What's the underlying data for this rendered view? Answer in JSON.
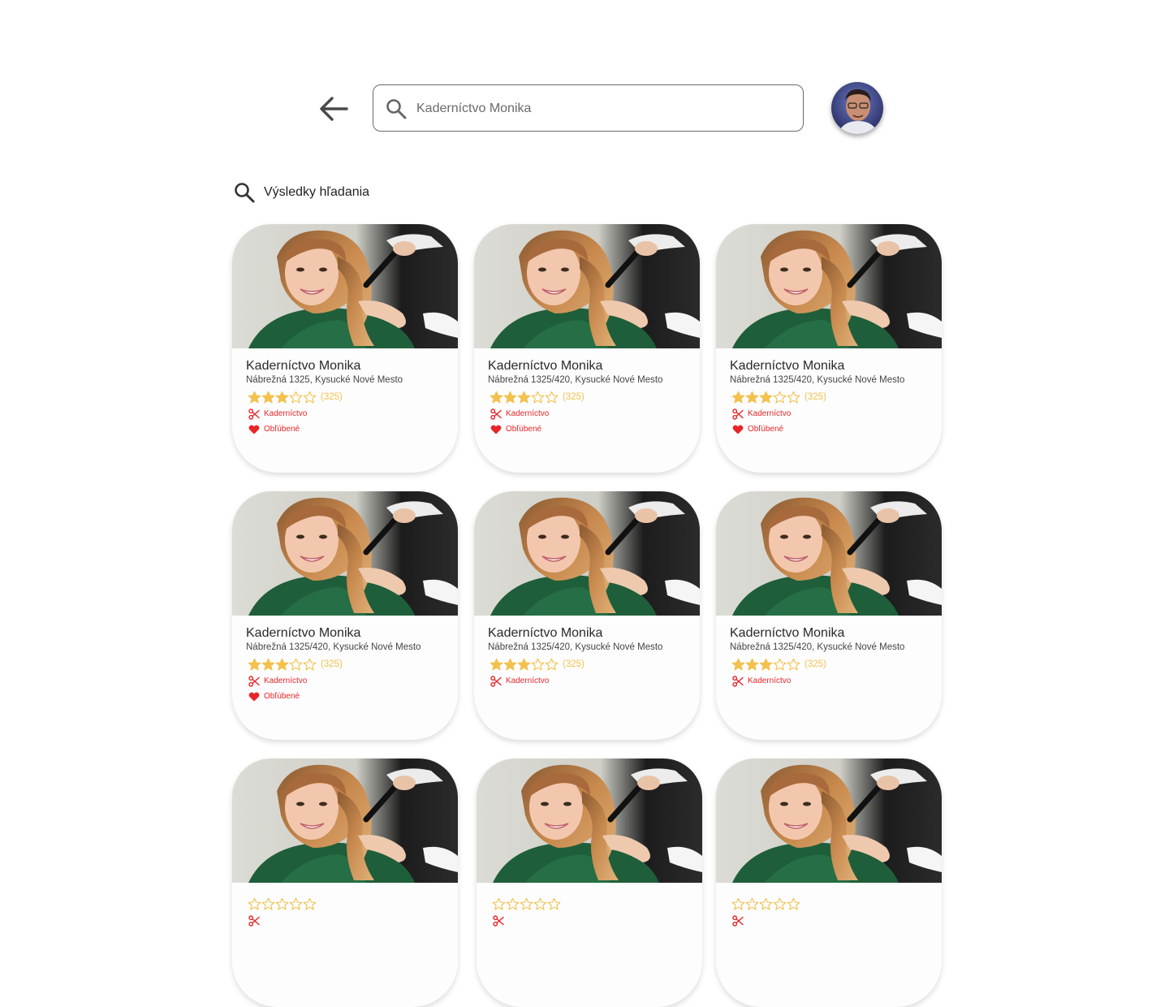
{
  "search": {
    "value": "Kaderníctvo Monika",
    "placeholder": "Kaderníctvo Monika"
  },
  "results_heading": "Výsledky hľadania",
  "colors": {
    "star": "#f2c14e",
    "accent_red": "#e8252a",
    "search_border": "#6b6b6b"
  },
  "icons": [
    "back-arrow-icon",
    "search-icon",
    "avatar",
    "star-icon",
    "scissors-icon",
    "heart-icon"
  ],
  "cards": [
    {
      "name": "Kaderníctvo Monika",
      "address": "Nábrežná 1325, Kysucké Nové Mesto",
      "rating": 3,
      "max_rating": 5,
      "review_count": "(325)",
      "category": "Kaderníctvo",
      "favorite_label": "Obľúbené"
    },
    {
      "name": "Kaderníctvo Monika",
      "address": "Nábrežná 1325/420, Kysucké Nové Mesto",
      "rating": 3,
      "max_rating": 5,
      "review_count": "(325)",
      "category": "Kaderníctvo",
      "favorite_label": "Obľúbené"
    },
    {
      "name": "Kaderníctvo Monika",
      "address": "Nábrežná 1325/420, Kysucké Nové Mesto",
      "rating": 3,
      "max_rating": 5,
      "review_count": "(325)",
      "category": "Kaderníctvo",
      "favorite_label": "Obľúbené"
    },
    {
      "name": "Kaderníctvo Monika",
      "address": "Nábrežná 1325/420, Kysucké Nové Mesto",
      "rating": 3,
      "max_rating": 5,
      "review_count": "(325)",
      "category": "Kaderníctvo",
      "favorite_label": "Obľúbené"
    },
    {
      "name": "Kaderníctvo Monika",
      "address": "Nábrežná 1325/420, Kysucké Nové Mesto",
      "rating": 3,
      "max_rating": 5,
      "review_count": "(325)",
      "category": "Kaderníctvo"
    },
    {
      "name": "Kaderníctvo Monika",
      "address": "Nábrežná 1325/420, Kysucké Nové Mesto",
      "rating": 3,
      "max_rating": 5,
      "review_count": "(325)",
      "category": "Kaderníctvo"
    },
    {
      "name": "",
      "address": "",
      "rating": 0,
      "max_rating": 5,
      "review_count": "",
      "category": ""
    },
    {
      "name": "",
      "address": "",
      "rating": 0,
      "max_rating": 5,
      "review_count": "",
      "category": ""
    },
    {
      "name": "",
      "address": "",
      "rating": 0,
      "max_rating": 5,
      "review_count": "",
      "category": ""
    }
  ]
}
